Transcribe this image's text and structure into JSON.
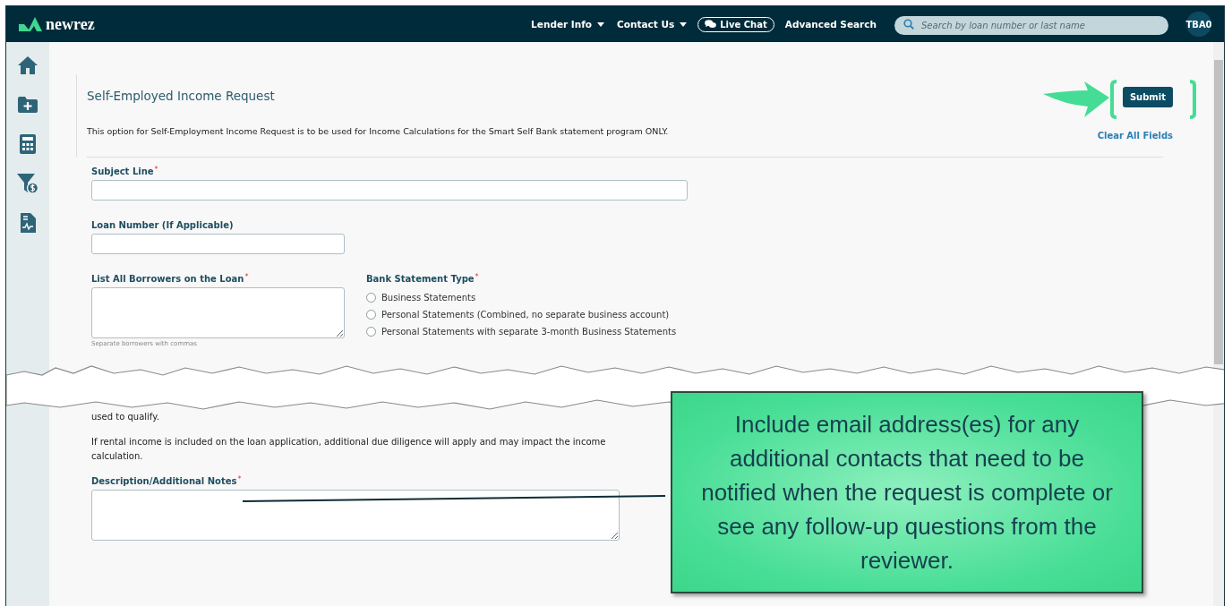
{
  "header": {
    "logo": "newrez",
    "nav": [
      {
        "label": "Lender Info",
        "kind": "dropdown"
      },
      {
        "label": "Contact Us",
        "kind": "dropdown"
      },
      {
        "label": "Live Chat",
        "kind": "chat"
      },
      {
        "label": "Advanced Search",
        "kind": "link"
      }
    ],
    "search": {
      "placeholder": "Search by loan number or last name"
    },
    "user": "TBA0"
  },
  "sidebar": {
    "items": [
      {
        "kind": "home"
      },
      {
        "kind": "folder-add"
      },
      {
        "kind": "calculator"
      },
      {
        "kind": "filter-dollar"
      },
      {
        "kind": "document-chart"
      }
    ]
  },
  "form": {
    "title": "Self-Employed Income Request",
    "intro": "This option for Self-Employment Income Request is to be used for Income Calculations for the Smart Self Bank statement program ONLY.",
    "submit": "Submit",
    "clear": "Clear All Fields",
    "subject": {
      "label": "Subject Line",
      "required_mark": "*"
    },
    "loan": {
      "label": "Loan Number (If Applicable)"
    },
    "borrowers": {
      "label": "List All Borrowers on the Loan",
      "required_mark": "*",
      "hint": "Separate borrowers with commas"
    },
    "statement_type": {
      "label": "Bank Statement Type",
      "required_mark": "*",
      "options": [
        {
          "label": "Business Statements",
          "selected": false
        },
        {
          "label": "Personal Statements (Combined, no separate business account)",
          "selected": false
        },
        {
          "label": "Personal Statements with separate 3-month Business Statements",
          "selected": false
        }
      ]
    },
    "continued_text": "used to qualify.",
    "rental_note": "If rental income is included on the loan application, additional due diligence will apply and may impact the income calculation.",
    "description": {
      "label": "Description/Additional Notes",
      "required_mark": "*"
    }
  },
  "callout": "Include email address(es) for any additional contacts that need to be notified when the request is complete or see any follow-up questions from the reviewer."
}
